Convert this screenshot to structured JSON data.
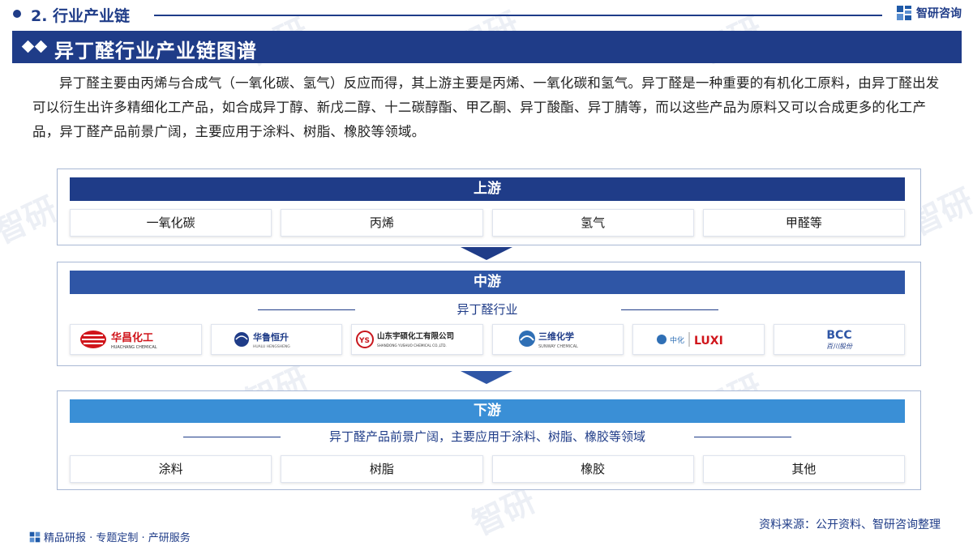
{
  "header": {
    "section_title": "2. 行业产业链",
    "brand": "智研咨询"
  },
  "title": "异丁醛行业产业链图谱",
  "intro": "异丁醛主要由丙烯与合成气（一氧化碳、氢气）反应而得，其上游主要是丙烯、一氧化碳和氢气。异丁醛是一种重要的有机化工原料，由异丁醛出发可以衍生出许多精细化工产品，如合成异丁醇、新戊二醇、十二碳醇酯、甲乙酮、异丁酸酯、异丁腈等，而以这些产品为原料又可以合成更多的化工产品，异丁醛产品前景广阔，主要应用于涂料、树脂、橡胶等领域。",
  "upstream": {
    "label": "上游",
    "items": [
      "一氧化碳",
      "丙烯",
      "氢气",
      "甲醛等"
    ]
  },
  "midstream": {
    "label": "中游",
    "subtitle": "异丁醛行业",
    "companies": [
      {
        "cn": "华昌化工",
        "en": "HUACHANG CHEMICAL"
      },
      {
        "cn": "华鲁恒升",
        "en": "HUALU HENGSHENG"
      },
      {
        "cn": "山东宇硕化工有限公司",
        "en": "SHANDONG YUSHUO CHEMICAL CO.,LTD."
      },
      {
        "cn": "三维化学",
        "en": "SUNWAY CHEMICAL"
      },
      {
        "cn": "中化",
        "en": "LUXI"
      },
      {
        "cn": "百川股份",
        "en": "BCC"
      }
    ]
  },
  "downstream": {
    "label": "下游",
    "subtitle": "异丁醛产品前景广阔，主要应用于涂料、树脂、橡胶等领域",
    "items": [
      "涂料",
      "树脂",
      "橡胶",
      "其他"
    ]
  },
  "footer": {
    "left": "精品研报 · 专题定制 · 产研服务",
    "source": "资料来源：公开资料、智研咨询整理"
  },
  "colors": {
    "navy": "#1f3c88",
    "mid_blue": "#2f56a6",
    "light_blue": "#3a8fd6"
  }
}
